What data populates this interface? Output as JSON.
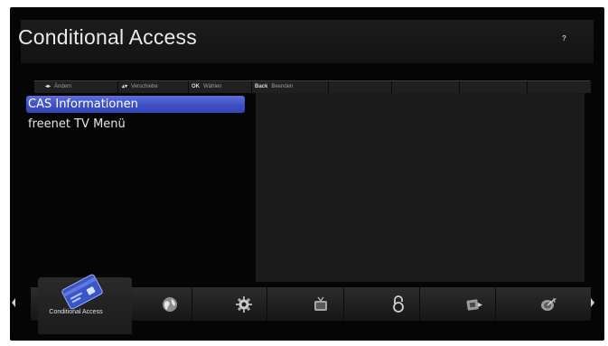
{
  "header": {
    "title": "Conditional Access",
    "help": "?"
  },
  "keybar": {
    "hints": [
      {
        "key": "◂▸",
        "label": "Ändern"
      },
      {
        "key": "▴▾",
        "label": "Verschiebe"
      },
      {
        "key": "OK",
        "label": "Wählen"
      },
      {
        "key": "Back",
        "label": "Beenden"
      }
    ]
  },
  "menu": {
    "items": [
      {
        "label": "CAS Informationen",
        "selected": true
      },
      {
        "label": "freenet TV Menü",
        "selected": false
      }
    ]
  },
  "dock": {
    "active_label": "Conditional Access",
    "icons": [
      "smartcard-icon",
      "globe-icon",
      "gear-icon",
      "tv-icon",
      "lock-icon",
      "media-icon",
      "satellite-icon"
    ]
  },
  "colors": {
    "selection": "#3d4fc4",
    "background": "#050505",
    "pane": "#1b1b1b"
  }
}
